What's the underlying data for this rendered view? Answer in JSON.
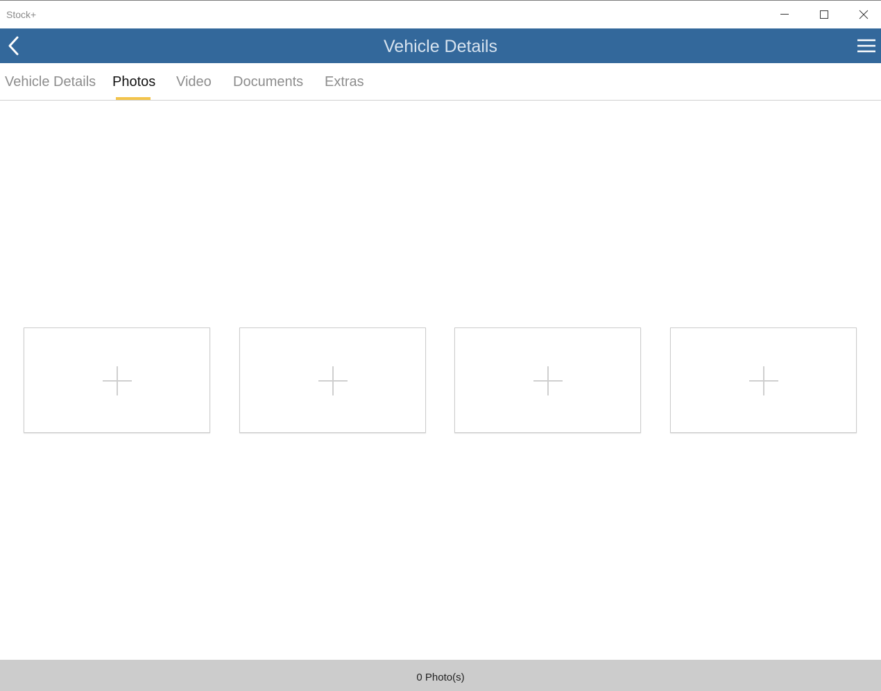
{
  "window": {
    "title": "Stock+",
    "controls": [
      "minimize-icon",
      "maximize-icon",
      "close-icon"
    ]
  },
  "header": {
    "title": "Vehicle Details",
    "background": "#33689b",
    "back_icon": "chevron-left-icon",
    "menu_icon": "hamburger-menu-icon"
  },
  "tabs": [
    {
      "label": "Vehicle Details",
      "active": false
    },
    {
      "label": "Photos",
      "active": true
    },
    {
      "label": "Video",
      "active": false
    },
    {
      "label": "Documents",
      "active": false
    },
    {
      "label": "Extras",
      "active": false
    }
  ],
  "tab_indicator_color": "#f3c44b",
  "photo_slots": [
    {
      "icon": "plus-icon"
    },
    {
      "icon": "plus-icon"
    },
    {
      "icon": "plus-icon"
    },
    {
      "icon": "plus-icon"
    }
  ],
  "footer": {
    "photo_count": "0 Photo(s)"
  }
}
